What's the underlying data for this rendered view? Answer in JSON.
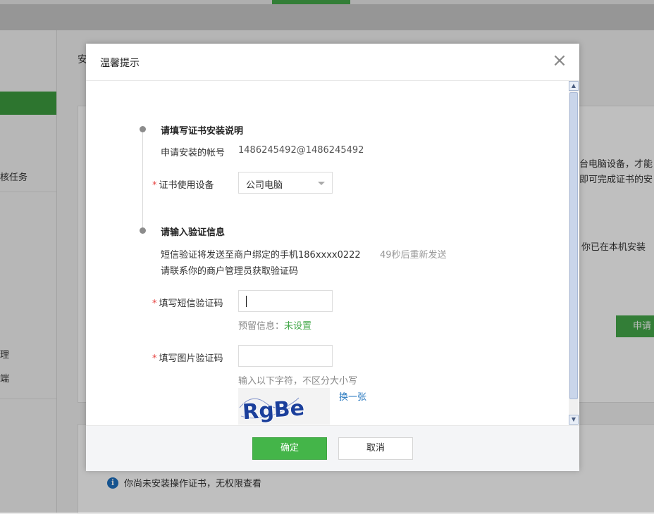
{
  "background": {
    "section_title": "安",
    "sidebar_items": [
      "核任务",
      "理",
      "端"
    ],
    "card_text_1": "台电脑设备，才能",
    "card_text_2": "即可完成证书的安",
    "card_text_3": "你已在本机安装",
    "apply_button": "申请",
    "info_text": "你尚未安装操作证书，无权限查看",
    "info_icon": "i"
  },
  "dialog": {
    "title": "温馨提示",
    "close_icon": "×",
    "step1": {
      "title": "请填写证书安装说明",
      "account_label": "申请安装的帐号",
      "account_value": "1486245492@1486245492",
      "device_label": "证书使用设备",
      "device_value": "公司电脑"
    },
    "step2": {
      "title": "请输入验证信息",
      "sms_info": "短信验证将发送至商户绑定的手机186xxxx0222",
      "resend": "49秒后重新发送",
      "contact_info": "请联系你的商户管理员获取验证码",
      "sms_code_label": "填写短信验证码",
      "reserved_info_label": "预留信息：",
      "reserved_info_value": "未设置",
      "img_code_label": "填写图片验证码",
      "img_code_hint": "输入以下字符，不区分大小写",
      "captcha_text": "RgBe",
      "refresh_link": "换一张"
    },
    "required_mark": "*",
    "ok_button": "确定",
    "cancel_button": "取消"
  },
  "colors": {
    "accent_green": "#44b549",
    "required_red": "#e64340",
    "link_blue": "#2a7ac0",
    "captcha_blue": "#1b3f9b"
  }
}
